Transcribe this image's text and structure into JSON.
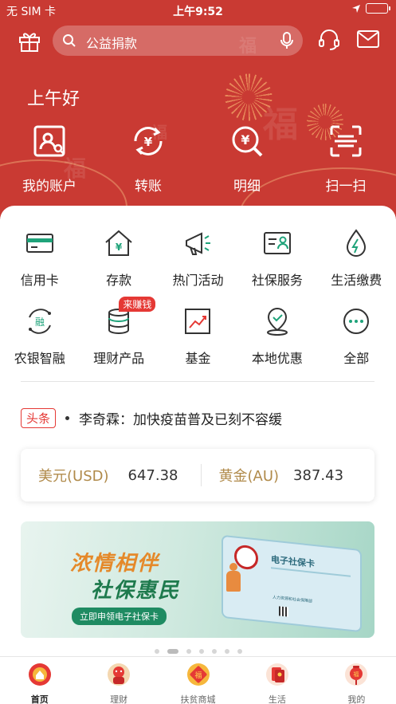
{
  "status": {
    "carrier": "无 SIM 卡",
    "time": "上午9:52"
  },
  "search": {
    "placeholder": "公益捐款"
  },
  "greeting": "上午好",
  "hero_nav": [
    {
      "label": "我的账户",
      "icon": "account-icon"
    },
    {
      "label": "转账",
      "icon": "transfer-icon"
    },
    {
      "label": "明细",
      "icon": "details-icon"
    },
    {
      "label": "扫一扫",
      "icon": "scan-icon"
    }
  ],
  "services": [
    {
      "label": "信用卡",
      "icon": "credit-card-icon"
    },
    {
      "label": "存款",
      "icon": "deposit-icon"
    },
    {
      "label": "热门活动",
      "icon": "megaphone-icon"
    },
    {
      "label": "社保服务",
      "icon": "social-security-icon"
    },
    {
      "label": "生活缴费",
      "icon": "utility-icon"
    },
    {
      "label": "农银智融",
      "icon": "smart-finance-icon"
    },
    {
      "label": "理财产品",
      "icon": "coin-stack-icon",
      "badge": "来赚钱"
    },
    {
      "label": "基金",
      "icon": "fund-chart-icon"
    },
    {
      "label": "本地优惠",
      "icon": "location-icon"
    },
    {
      "label": "全部",
      "icon": "more-icon"
    }
  ],
  "news": {
    "tag": "头条",
    "text": "李奇霖：加快疫苗普及已刻不容缓"
  },
  "rates": [
    {
      "label": "美元(USD)",
      "value": "647.38"
    },
    {
      "label": "黄金(AU)",
      "value": "387.43"
    }
  ],
  "banner": {
    "line1": "浓情相伴",
    "line2": "社保惠民",
    "button": "立即申领电子社保卡",
    "card_title": "电子社保卡",
    "card_org": "人力资源和社会保障部"
  },
  "tabs": [
    {
      "label": "首页",
      "icon": "home-icon",
      "active": true
    },
    {
      "label": "理财",
      "icon": "wealth-icon"
    },
    {
      "label": "扶贫商城",
      "icon": "mall-icon"
    },
    {
      "label": "生活",
      "icon": "life-icon"
    },
    {
      "label": "我的",
      "icon": "profile-icon"
    }
  ],
  "colors": {
    "brand_red": "#c93a33",
    "accent_green": "#1fa37a",
    "gold": "#b08a4a",
    "badge_red": "#e53935"
  }
}
